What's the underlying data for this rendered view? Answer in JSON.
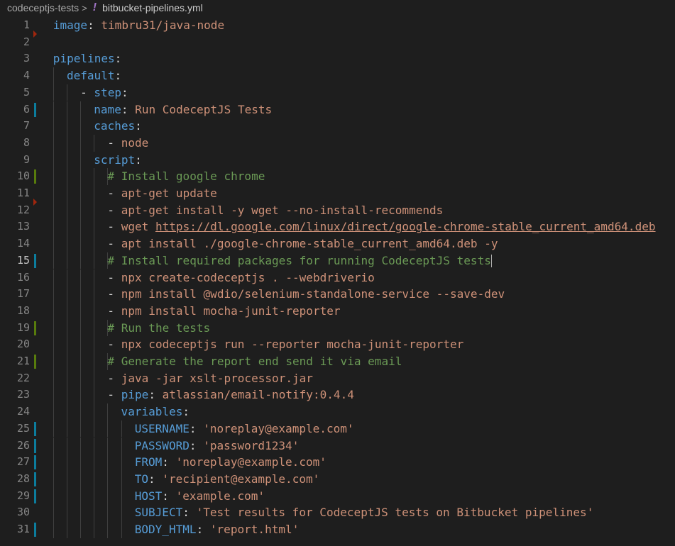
{
  "breadcrumb": {
    "folder": "codeceptjs-tests",
    "separator": ">",
    "file_icon": "!",
    "file": "bitbucket-pipelines.yml"
  },
  "editor": {
    "active_line": 15,
    "lines": [
      {
        "num": "1",
        "key": "image",
        "value": "timbru31/java-node"
      },
      {
        "num": "2"
      },
      {
        "num": "3",
        "key": "pipelines"
      },
      {
        "num": "4",
        "key": "default"
      },
      {
        "num": "5",
        "dash": "- ",
        "key": "step"
      },
      {
        "num": "6",
        "key": "name",
        "value": "Run CodeceptJS Tests"
      },
      {
        "num": "7",
        "key": "caches"
      },
      {
        "num": "8",
        "dash": "- ",
        "value": "node"
      },
      {
        "num": "9",
        "key": "script"
      },
      {
        "num": "10",
        "comment": "# Install google chrome"
      },
      {
        "num": "11",
        "dash": "- ",
        "value": "apt-get update"
      },
      {
        "num": "12",
        "dash": "- ",
        "value": "apt-get install -y wget --no-install-recommends"
      },
      {
        "num": "13",
        "dash": "- ",
        "value": "wget ",
        "link": "https://dl.google.com/linux/direct/google-chrome-stable_current_amd64.deb"
      },
      {
        "num": "14",
        "dash": "- ",
        "value": "apt install ./google-chrome-stable_current_amd64.deb -y"
      },
      {
        "num": "15",
        "comment": "# Install required packages for running CodeceptJS tests"
      },
      {
        "num": "16",
        "dash": "- ",
        "value": "npx create-codeceptjs . --webdriverio"
      },
      {
        "num": "17",
        "dash": "- ",
        "value": "npm install @wdio/selenium-standalone-service --save-dev"
      },
      {
        "num": "18",
        "dash": "- ",
        "value": "npm install mocha-junit-reporter"
      },
      {
        "num": "19",
        "comment": "# Run the tests"
      },
      {
        "num": "20",
        "dash": "- ",
        "value": "npx codeceptjs run --reporter mocha-junit-reporter"
      },
      {
        "num": "21",
        "comment": "# Generate the report end send it via email"
      },
      {
        "num": "22",
        "dash": "- ",
        "value": "java -jar xslt-processor.jar"
      },
      {
        "num": "23",
        "dash": "- ",
        "key": "pipe",
        "value": "atlassian/email-notify:0.4.4"
      },
      {
        "num": "24",
        "key": "variables"
      },
      {
        "num": "25",
        "key": "USERNAME",
        "value": "'noreplay@example.com'"
      },
      {
        "num": "26",
        "key": "PASSWORD",
        "value": "'password1234'"
      },
      {
        "num": "27",
        "key": "FROM",
        "value": "'noreplay@example.com'"
      },
      {
        "num": "28",
        "key": "TO",
        "value": "'recipient@example.com'"
      },
      {
        "num": "29",
        "key": "HOST",
        "value": "'example.com'"
      },
      {
        "num": "30",
        "key": "SUBJECT",
        "value": "'Test results for CodeceptJS tests on Bitbucket pipelines'"
      },
      {
        "num": "31",
        "key": "BODY_HTML",
        "value": "'report.html'"
      }
    ]
  },
  "colors": {
    "background": "#1e1e1e",
    "key": "#569cd6",
    "string": "#ce9178",
    "comment": "#6a9955",
    "line_number": "#858585",
    "modified_marker": "#0c7d9d",
    "added_marker": "#587c0c",
    "deleted_marker": "#a1260d"
  }
}
